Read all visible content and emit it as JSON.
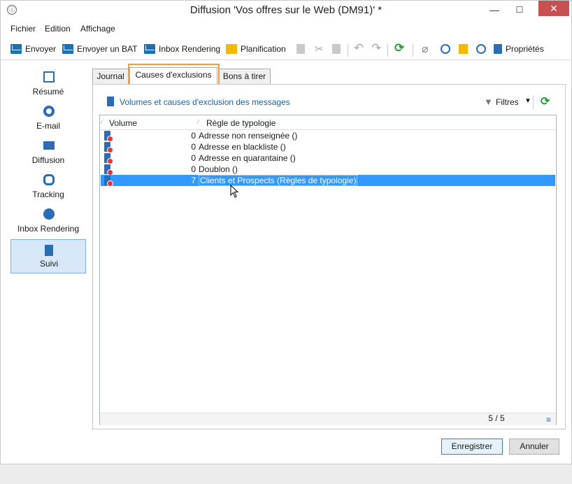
{
  "window": {
    "title": "Diffusion 'Vos offres sur le Web (DM91)' *"
  },
  "menu": [
    "Fichier",
    "Edition",
    "Affichage"
  ],
  "toolbar": {
    "envoyer": "Envoyer",
    "envoyer_bat": "Envoyer un BAT",
    "inbox_rendering": "Inbox Rendering",
    "planification": "Planification",
    "proprietes": "Propriétés"
  },
  "sidebar": [
    {
      "label": "Résumé",
      "icon": "summary-icon"
    },
    {
      "label": "E-mail",
      "icon": "email-lifebuoy-icon"
    },
    {
      "label": "Diffusion",
      "icon": "diffusion-icon"
    },
    {
      "label": "Tracking",
      "icon": "tracking-link-icon"
    },
    {
      "label": "Inbox Rendering",
      "icon": "globe-icon"
    },
    {
      "label": "Suivi",
      "icon": "followup-icon",
      "active": true
    }
  ],
  "tabs": [
    "Journal",
    "Causes d'exclusions",
    "Bons à tirer"
  ],
  "panel": {
    "heading": "Volumes et causes d'exclusion des messages",
    "filters": "Filtres",
    "columns": {
      "volume": "Volume",
      "rule": "Règle de typologie"
    },
    "rows": [
      {
        "volume": "0",
        "rule": "Adresse non renseignée ()"
      },
      {
        "volume": "0",
        "rule": "Adresse en blackliste ()"
      },
      {
        "volume": "0",
        "rule": "Adresse en quarantaine ()"
      },
      {
        "volume": "0",
        "rule": "Doublon ()"
      },
      {
        "volume": "7",
        "rule": "Clients et Prospects (Règles de typologie)"
      }
    ],
    "count": "5 / 5"
  },
  "buttons": {
    "save": "Enregistrer",
    "cancel": "Annuler"
  },
  "colors": {
    "accent": "#f39a3c",
    "selection": "#3399ff",
    "sidebar_active": "#d9e8f8"
  }
}
